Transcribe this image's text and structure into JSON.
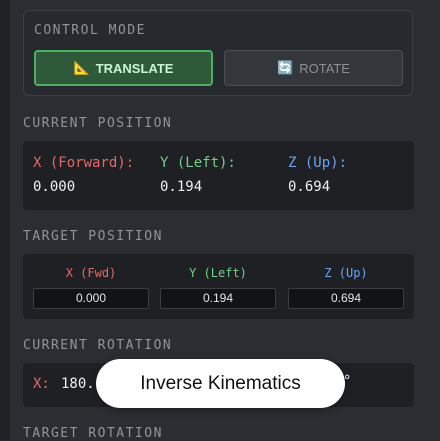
{
  "control_mode": {
    "title": "CONTROL MODE",
    "translate_label": "TRANSLATE",
    "rotate_label": "ROTATE",
    "translate_icon": "📐",
    "rotate_icon": "🔄"
  },
  "current_position": {
    "title": "CURRENT POSITION",
    "x_label": "X (Forward):",
    "y_label": "Y (Left):",
    "z_label": "Z (Up):",
    "x_value": "0.000",
    "y_value": "0.194",
    "z_value": "0.694"
  },
  "target_position": {
    "title": "TARGET POSITION",
    "x_label": "X (Fwd)",
    "y_label": "Y (Left)",
    "z_label": "Z (Up)",
    "x_value": "0.000",
    "y_value": "0.194",
    "z_value": "0.694"
  },
  "current_rotation": {
    "title": "CURRENT ROTATION",
    "x_label": "X:",
    "x_value": "180.",
    "degree_suffix": "°"
  },
  "target_rotation": {
    "title": "TARGET ROTATION"
  },
  "toast": {
    "text": "Inverse Kinematics"
  },
  "colors": {
    "x_axis": "#e36a6a",
    "y_axis": "#74d08a",
    "z_axis": "#6da4f2",
    "active_mode": "#4caf64"
  }
}
